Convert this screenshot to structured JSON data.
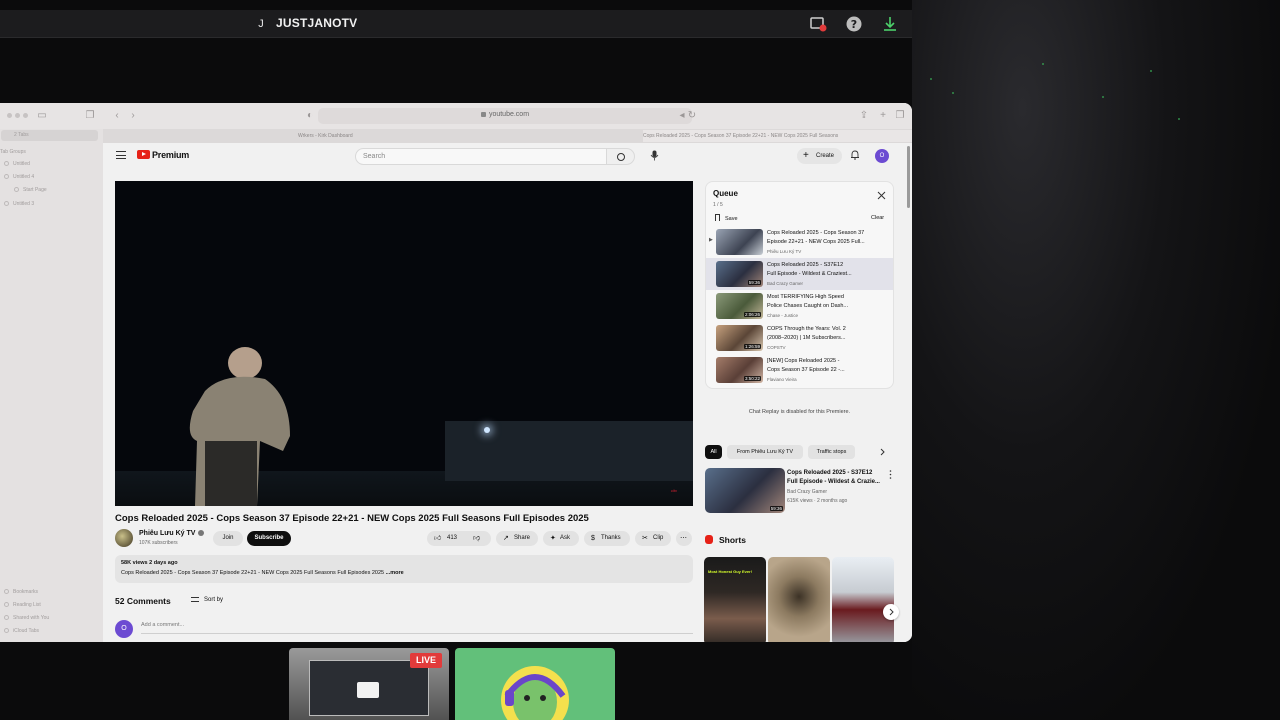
{
  "host": {
    "avatar_initial": "J",
    "name": "JUSTJANOTV"
  },
  "browser": {
    "url": "youtube.com",
    "tabs": [
      "Wrkers - Kirk Dashboard",
      "Cops Reloaded 2025 - Cops Season 37 Episode 22+21 - NEW Cops 2025 Full Seasons"
    ],
    "sidebar": {
      "tabs_label": "2 Tabs",
      "groups_label": "Tab Groups",
      "groups": [
        "Untitled",
        "Untitled 4",
        "Start Page",
        "Untitled 3"
      ],
      "bottom": [
        "Bookmarks",
        "Reading List",
        "Shared with You",
        "iCloud Tabs"
      ]
    }
  },
  "youtube": {
    "brand": "Premium",
    "search_placeholder": "Search",
    "create_label": "Create",
    "user_initial": "O",
    "video": {
      "watermark": "citv",
      "title": "Cops Reloaded 2025 - Cops Season 37 Episode 22+21 - NEW Cops 2025 Full Seasons Full Episodes 2025",
      "channel": "Phiêu Lưu Ký TV",
      "subscribers": "107K subscribers",
      "join_label": "Join",
      "subscribe_label": "Subscribe",
      "likes": "413",
      "share_label": "Share",
      "ask_label": "Ask",
      "thanks_label": "Thanks",
      "clip_label": "Clip",
      "description_meta": "58K views  2 days ago",
      "description_text": "Cops Reloaded 2025 - Cops Season 37 Episode 22+21 - NEW Cops 2025 Full Seasons Full Episodes 2025 ",
      "description_more": "...more"
    },
    "comments": {
      "count_label": "52 Comments",
      "sort_label": "Sort by",
      "placeholder": "Add a comment..."
    },
    "queue": {
      "title": "Queue",
      "count": "1 / 5",
      "save_label": "Save",
      "clear_label": "Clear",
      "items": [
        {
          "line1": "Cops Reloaded 2025 - Cops Season 37",
          "line2": "Episode 22+21 - NEW Cops 2025 Full...",
          "channel": "Phiêu Lưu Ký TV",
          "duration": "",
          "playing": false
        },
        {
          "line1": "Cops Reloaded 2025 - S37E12",
          "line2": "Full Episode - Wildest & Craziest...",
          "channel": "Bad Crazy Gamer",
          "duration": "59:36",
          "playing": true
        },
        {
          "line1": "Most TERRIFYING High Speed",
          "line2": "Police Chases Caught on Dash...",
          "channel": "Chase - Justice",
          "duration": "2:06:26",
          "playing": false
        },
        {
          "line1": "COPS Through the Years: Vol. 2",
          "line2": "(2008–2020) | 1M Subscribers...",
          "channel": "COPSTV",
          "duration": "1:26:59",
          "playing": false
        },
        {
          "line1": "[NEW] Cops Reloaded 2025 -",
          "line2": "Cops Season 37 Episode 22 -...",
          "channel": "Flaviano Vieira",
          "duration": "3:50:22",
          "playing": false
        }
      ]
    },
    "chat_replay": "Chat Replay is disabled for this Premiere.",
    "chips": [
      "All",
      "From Phiêu Lưu Ký TV",
      "Traffic stops"
    ],
    "recommended": {
      "title_line1": "Cops Reloaded 2025 - S37E12",
      "title_line2": "Full Episode - Wildest & Crazie...",
      "channel": "Bad Crazy Gamer",
      "meta": "615K views · 2 months ago",
      "duration": "59:36"
    },
    "shorts": {
      "header": "Shorts",
      "caption": "Most Honest Guy Ever!"
    }
  },
  "stream": {
    "live_label": "LIVE"
  },
  "colors": {
    "accent_red": "#e62117",
    "subscribe_black": "#0f0f0f",
    "avatar_purple": "#6c4bd2",
    "live_red": "#e13b3b"
  }
}
